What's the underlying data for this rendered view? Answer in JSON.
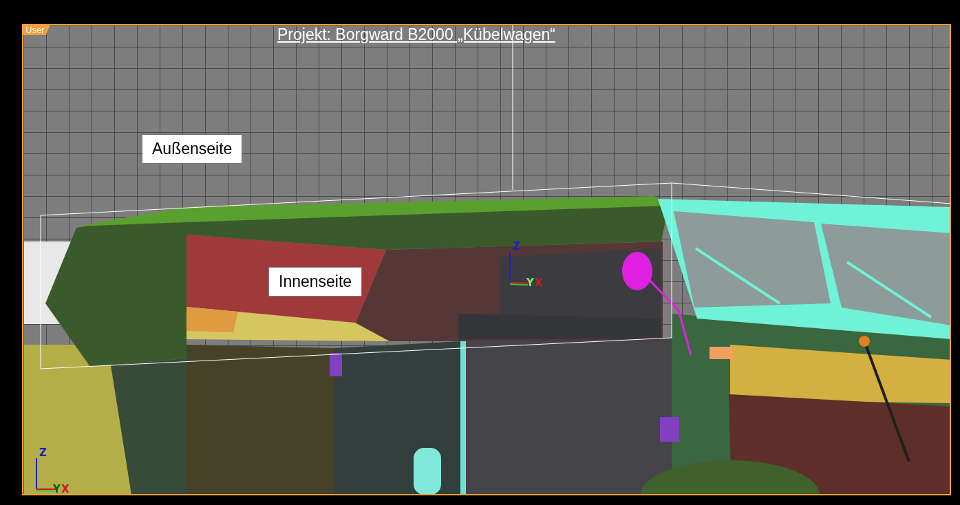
{
  "viewport": {
    "label": "User",
    "title": "Projekt: Borgward B2000 „Kübelwagen“"
  },
  "annotations": [
    {
      "text": "Außenseite"
    },
    {
      "text": "Innenseite"
    }
  ],
  "axis_gizmos": [
    {
      "labels": [
        "Z",
        "Y",
        "X"
      ]
    },
    {
      "labels": [
        "Z",
        "Y",
        "X"
      ]
    }
  ]
}
